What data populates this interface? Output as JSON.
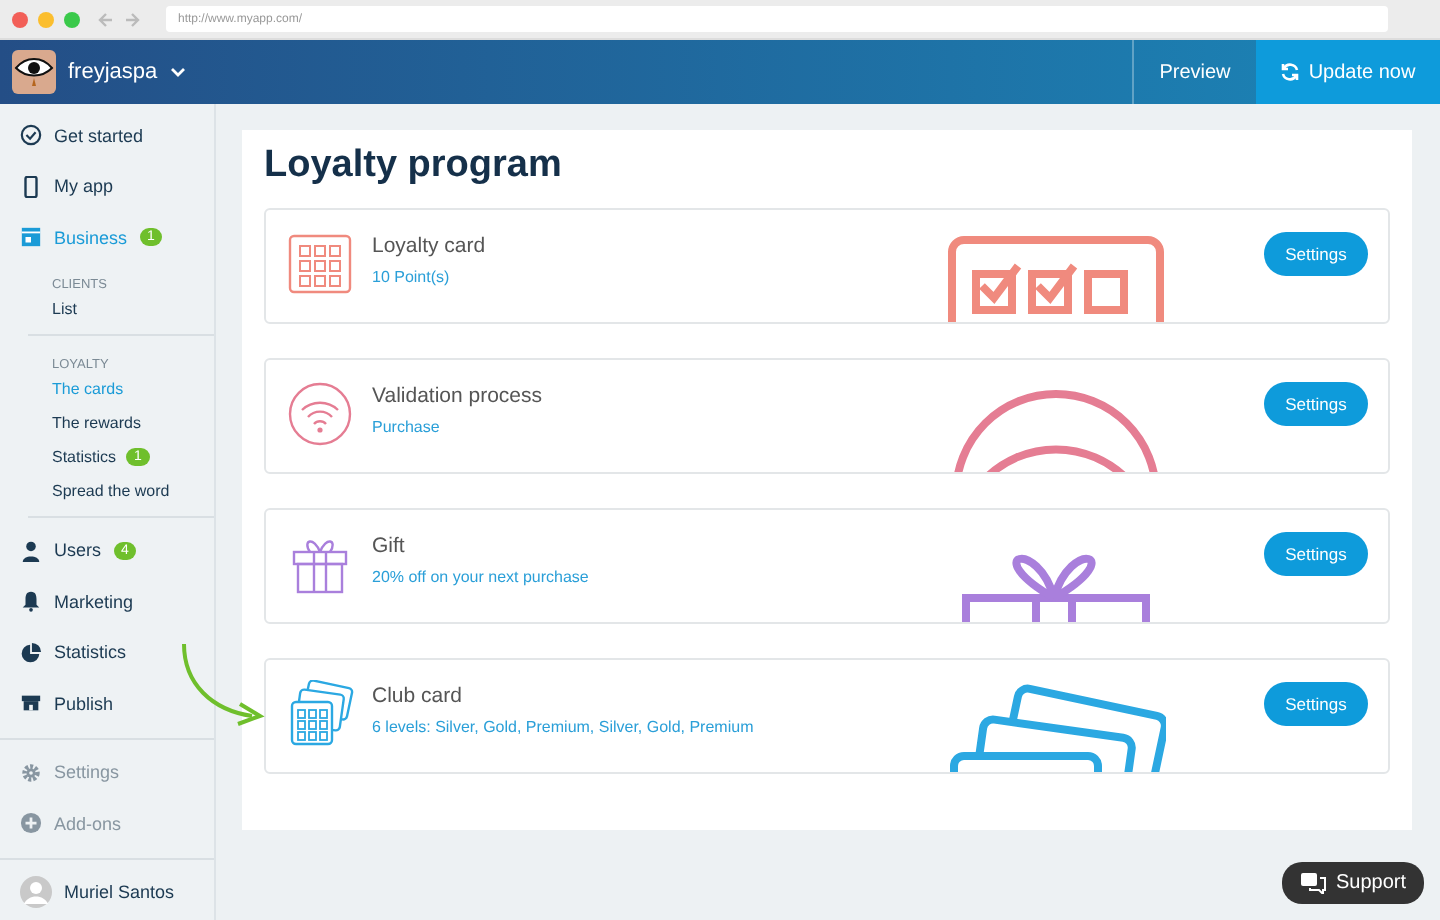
{
  "browser": {
    "url": "http://www.myapp.com/"
  },
  "app_bar": {
    "account": "freyjaspa",
    "preview": "Preview",
    "update": "Update now"
  },
  "sidebar": {
    "groups": [
      {
        "items": [
          {
            "kind": "nav",
            "label": "Get started",
            "selected": false,
            "disabled": false
          },
          {
            "kind": "nav",
            "label": "My app",
            "selected": false,
            "disabled": false
          },
          {
            "kind": "nav",
            "label": "Business",
            "selected": true,
            "disabled": false,
            "badge": "1"
          },
          {
            "kind": "heading",
            "label": "CLIENTS"
          },
          {
            "kind": "sub",
            "label": "List",
            "selected": false
          }
        ]
      },
      {
        "items": [
          {
            "kind": "heading",
            "label": "LOYALTY"
          },
          {
            "kind": "sub",
            "label": "The cards",
            "selected": true
          },
          {
            "kind": "sub",
            "label": "The rewards",
            "selected": false
          },
          {
            "kind": "sub",
            "label": "Statistics",
            "selected": false,
            "badge": "1"
          },
          {
            "kind": "sub",
            "label": "Spread the word",
            "selected": false
          }
        ]
      },
      {
        "items": [
          {
            "kind": "nav",
            "label": "Users",
            "selected": false,
            "disabled": false,
            "badge": "4"
          },
          {
            "kind": "nav",
            "label": "Marketing",
            "selected": false,
            "disabled": false
          },
          {
            "kind": "nav",
            "label": "Statistics",
            "selected": false,
            "disabled": false
          },
          {
            "kind": "nav",
            "label": "Publish",
            "selected": false,
            "disabled": false
          }
        ]
      },
      {
        "items": [
          {
            "kind": "nav",
            "label": "Settings",
            "selected": false,
            "disabled": true
          },
          {
            "kind": "nav",
            "label": "Add-ons",
            "selected": false,
            "disabled": true
          }
        ]
      },
      {
        "items": [
          {
            "kind": "user",
            "label": "Muriel Santos"
          }
        ]
      }
    ]
  },
  "page": {
    "title": "Loyalty program",
    "cards": [
      {
        "title": "Loyalty card",
        "subtitle": "10 Point(s)",
        "color": "#f08a7e",
        "button": "Settings"
      },
      {
        "title": "Validation process",
        "subtitle": "Purchase",
        "color": "#e57d93",
        "button": "Settings"
      },
      {
        "title": "Gift",
        "subtitle": "20% off on your next purchase",
        "color": "#a97fdc",
        "button": "Settings"
      },
      {
        "title": "Club card",
        "subtitle": "6 levels: Silver, Gold, Premium, Silver, Gold, Premium",
        "color": "#2ba8e2",
        "button": "Settings"
      }
    ]
  },
  "support": {
    "label": "Support"
  }
}
